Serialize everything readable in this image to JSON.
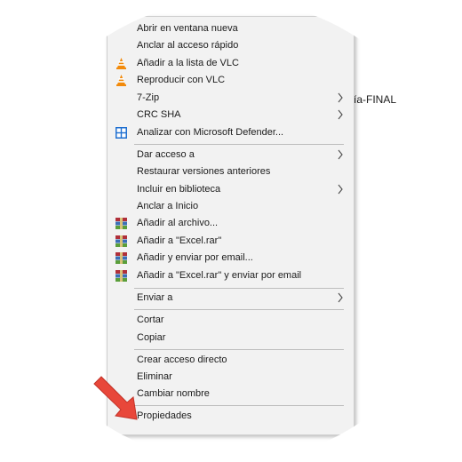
{
  "background": {
    "filename_fragment": "ía-FINAL"
  },
  "menu": {
    "group1": [
      {
        "label": "Abrir en ventana nueva",
        "icon": null
      },
      {
        "label": "Anclar al acceso rápido",
        "icon": null
      },
      {
        "label": "Añadir a la lista de VLC",
        "icon": "vlc-cone-icon"
      },
      {
        "label": "Reproducir con VLC",
        "icon": "vlc-cone-icon"
      },
      {
        "label": "7-Zip",
        "icon": null,
        "submenu": true
      },
      {
        "label": "CRC SHA",
        "icon": null,
        "submenu": true
      },
      {
        "label": "Analizar con Microsoft Defender...",
        "icon": "defender-shield-icon"
      }
    ],
    "group2": [
      {
        "label": "Dar acceso a",
        "icon": null,
        "submenu": true
      },
      {
        "label": "Restaurar versiones anteriores",
        "icon": null
      },
      {
        "label": "Incluir en biblioteca",
        "icon": null,
        "submenu": true
      },
      {
        "label": "Anclar a Inicio",
        "icon": null
      },
      {
        "label": "Añadir al archivo...",
        "icon": "winrar-icon"
      },
      {
        "label": "Añadir a \"Excel.rar\"",
        "icon": "winrar-icon"
      },
      {
        "label": "Añadir y enviar por email...",
        "icon": "winrar-icon"
      },
      {
        "label": "Añadir a \"Excel.rar\" y enviar por email",
        "icon": "winrar-icon"
      }
    ],
    "group3": [
      {
        "label": "Enviar a",
        "icon": null,
        "submenu": true
      }
    ],
    "group4": [
      {
        "label": "Cortar",
        "icon": null
      },
      {
        "label": "Copiar",
        "icon": null
      }
    ],
    "group5": [
      {
        "label": "Crear acceso directo",
        "icon": null
      },
      {
        "label": "Eliminar",
        "icon": null
      },
      {
        "label": "Cambiar nombre",
        "icon": null
      }
    ],
    "group6": [
      {
        "label": "Propiedades",
        "icon": null
      }
    ]
  },
  "colors": {
    "menu_bg": "#f2f2f2",
    "vlc_orange": "#f28a0b",
    "defender_blue": "#1f6fd0",
    "winrar_red": "#b0303a",
    "annotation_arrow": "#e8473a"
  }
}
